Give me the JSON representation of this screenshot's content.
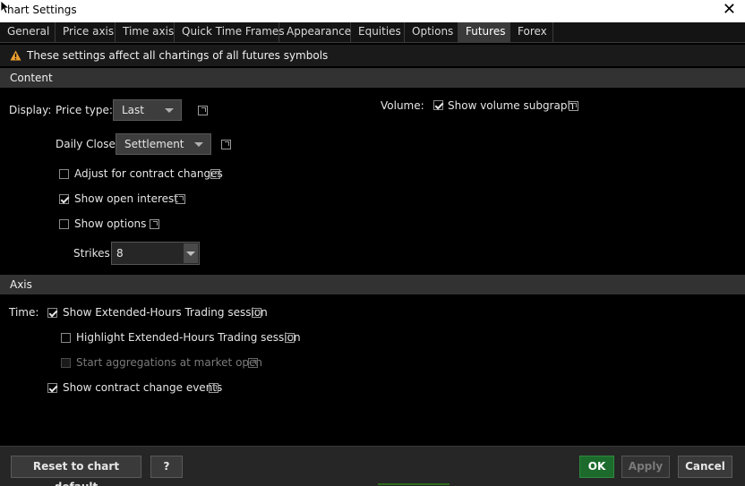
{
  "window": {
    "title": "hart Settings"
  },
  "tabs": [
    {
      "label": "General"
    },
    {
      "label": "Price axis"
    },
    {
      "label": "Time axis"
    },
    {
      "label": "Quick Time Frames"
    },
    {
      "label": "Appearance"
    },
    {
      "label": "Equities"
    },
    {
      "label": "Options"
    },
    {
      "label": "Futures"
    },
    {
      "label": "Forex"
    }
  ],
  "active_tab": "Futures",
  "notice": {
    "text": "These settings affect all chartings of all futures symbols",
    "icon": "warning-icon",
    "icon_color": "#f0a030"
  },
  "content": {
    "section_label": "Content",
    "display_label": "Display:",
    "price_type_label": "Price type:",
    "price_type_value": "Last",
    "volume_label": "Volume:",
    "show_volume_subgraph_label": "Show volume subgraph",
    "show_volume_subgraph_checked": true,
    "daily_close_label": "Daily Close:",
    "daily_close_value": "Settlement",
    "adjust_contract_label": "Adjust for contract changes",
    "adjust_contract_checked": false,
    "show_open_interest_label": "Show open interest",
    "show_open_interest_checked": true,
    "show_options_label": "Show options",
    "show_options_checked": false,
    "strikes_label": "Strikes:",
    "strikes_value": "8"
  },
  "axis": {
    "section_label": "Axis",
    "time_label": "Time:",
    "show_eth_label": "Show Extended-Hours Trading session",
    "show_eth_checked": true,
    "highlight_eth_label": "Highlight Extended-Hours Trading session",
    "highlight_eth_checked": false,
    "start_aggregations_label": "Start aggregations at market open",
    "start_aggregations_checked": false,
    "show_contract_change_label": "Show contract change events",
    "show_contract_change_checked": true
  },
  "footer": {
    "reset_label": "Reset to chart default",
    "help_label": "?",
    "ok_label": "OK",
    "apply_label": "Apply",
    "cancel_label": "Cancel"
  },
  "colors": {
    "accent_green": "#1c6b2c",
    "section_bg": "#323232",
    "background": "#000000"
  }
}
